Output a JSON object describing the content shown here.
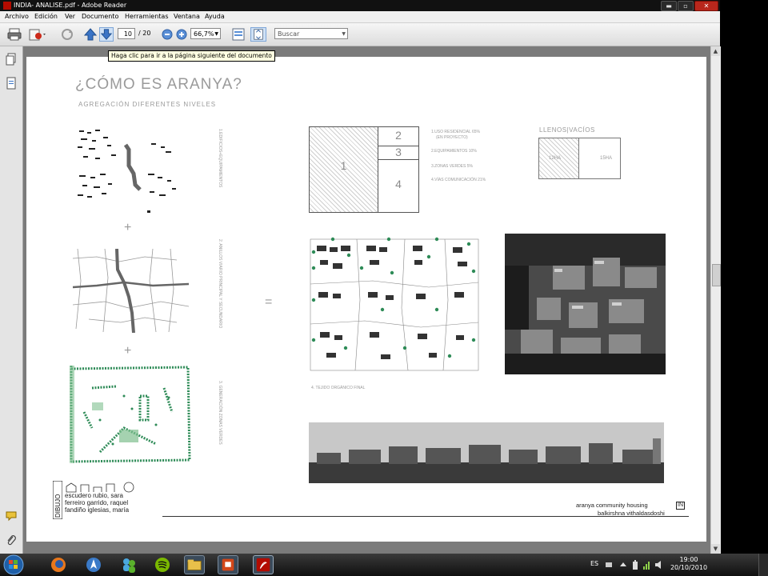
{
  "window": {
    "title": "INDIA- ANALISE.pdf - Adobe Reader",
    "minimize_glyph": "▬",
    "maximize_glyph": "▫",
    "close_glyph": "✕"
  },
  "menu": [
    "Archivo",
    "Edición",
    "Ver",
    "Documento",
    "Herramientas",
    "Ventana",
    "Ayuda"
  ],
  "toolbar": {
    "page_current": "10",
    "page_total": "/ 20",
    "zoom": "66,7%",
    "search_placeholder": "Buscar",
    "tooltip": "Haga clic para ir a la página siguiente del documento"
  },
  "page": {
    "title": "¿CÓMO ES ARANYA?",
    "subtitle": "AGREGACIÓN DIFERENTES NIVELES",
    "level_labels": [
      "1.EDIFICIOS+EQUIPAMIENTOS",
      "2. ANILLOS VIARIO PRINCIPAL Y SECUNDARIO",
      "3. GENERACIÓN ZONAS VERDES"
    ],
    "plus": "+",
    "equals": "=",
    "blocks": [
      "1",
      "2",
      "3",
      "4"
    ],
    "legend": [
      "1.USO RESIDENCIAL 65%",
      "(EN PROYECTO)",
      "2.EQUIPAMIENTOS 10%",
      "3.ZONAS VERDES 5%",
      "4.VÍAS COMUNICACIÓN 21%"
    ],
    "llenos_vacios": {
      "title": "LLENOS|VACÍOS",
      "filled": "12HA",
      "empty": "15HA"
    },
    "tejido_caption": "4. TEJIDO ORGÁNICO FINAL",
    "footer": {
      "vertical_label": "DIBUJO",
      "authors": [
        "escudero rubio, sara",
        "ferreiro garrido, raquel",
        "fandiño iglesias, maría"
      ],
      "project_line1": "aranya community housing",
      "project_line2": "balkirshna vithaldasdoshi",
      "project_badge": "IN"
    }
  },
  "taskbar": {
    "language": "ES",
    "time": "19:00",
    "date": "20/10/2010"
  },
  "colors": {
    "green": "#2e8b57",
    "green_light": "#7fbf8f",
    "title_gray": "#9a9a9a",
    "accent_red": "#b30b00"
  }
}
